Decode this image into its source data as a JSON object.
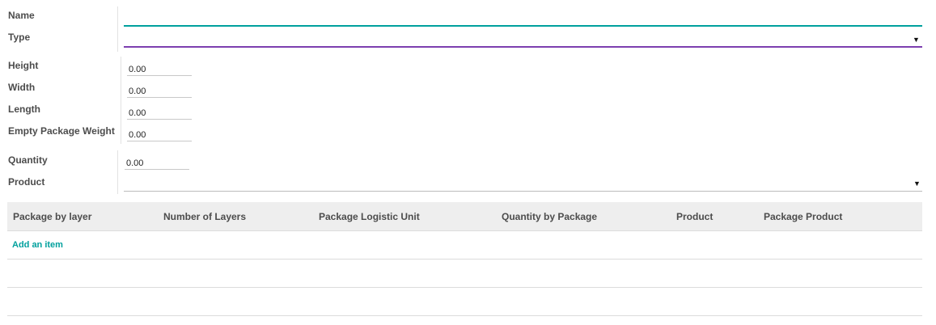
{
  "form": {
    "name": {
      "label": "Name",
      "value": ""
    },
    "type": {
      "label": "Type",
      "value": "",
      "caret": "▼"
    },
    "dimensions": [
      {
        "label": "Height",
        "value": "0.00"
      },
      {
        "label": "Width",
        "value": "0.00"
      },
      {
        "label": "Length",
        "value": "0.00"
      },
      {
        "label": "Empty Package Weight",
        "value": "0.00"
      }
    ],
    "quantity": {
      "label": "Quantity",
      "value": "0.00"
    },
    "product": {
      "label": "Product",
      "value": "",
      "caret": "▼"
    }
  },
  "table": {
    "columns": [
      "Package by layer",
      "Number of Layers",
      "Package Logistic Unit",
      "Quantity by Package",
      "Product",
      "Package Product"
    ],
    "add_item_label": "Add an item"
  },
  "colors": {
    "accent_teal": "#00a09d",
    "accent_purple": "#7c3fb0"
  }
}
